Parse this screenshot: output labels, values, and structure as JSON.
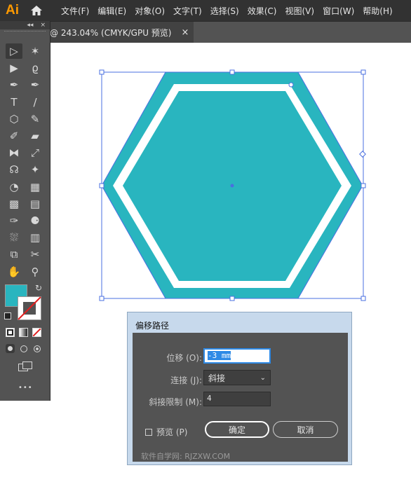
{
  "app": {
    "logo": "Ai"
  },
  "menu": [
    "文件(F)",
    "编辑(E)",
    "对象(O)",
    "文字(T)",
    "选择(S)",
    "效果(C)",
    "视图(V)",
    "窗口(W)",
    "帮助(H)"
  ],
  "toolbar_header": {
    "collapse": "◂◂",
    "close": "×"
  },
  "document_tab": {
    "title": "@ 243.04% (CMYK/GPU 预览)",
    "close": "×"
  },
  "tools": [
    {
      "name": "selection-tool",
      "glyph": "▷"
    },
    {
      "name": "magic-wand-tool",
      "glyph": "✶"
    },
    {
      "name": "direct-selection-tool",
      "glyph": "▶"
    },
    {
      "name": "lasso-tool",
      "glyph": "ϱ"
    },
    {
      "name": "pen-tool",
      "glyph": "✒"
    },
    {
      "name": "curvature-tool",
      "glyph": "✒"
    },
    {
      "name": "type-tool",
      "glyph": "T"
    },
    {
      "name": "line-segment-tool",
      "glyph": "/"
    },
    {
      "name": "polygon-tool",
      "glyph": "⬡"
    },
    {
      "name": "paintbrush-tool",
      "glyph": "✎"
    },
    {
      "name": "shaper-tool",
      "glyph": "✐"
    },
    {
      "name": "eraser-tool",
      "glyph": "▰"
    },
    {
      "name": "reflect-tool",
      "glyph": "⧓"
    },
    {
      "name": "scale-tool",
      "glyph": "⤢"
    },
    {
      "name": "warp-tool",
      "glyph": "☊"
    },
    {
      "name": "puppet-warp-tool",
      "glyph": "✦"
    },
    {
      "name": "shape-builder-tool",
      "glyph": "◔"
    },
    {
      "name": "perspective-grid-tool",
      "glyph": "▦"
    },
    {
      "name": "mesh-tool",
      "glyph": "▩"
    },
    {
      "name": "gradient-tool",
      "glyph": "▤"
    },
    {
      "name": "eyedropper-tool",
      "glyph": "✑"
    },
    {
      "name": "blend-tool",
      "glyph": "⚈"
    },
    {
      "name": "symbol-sprayer-tool",
      "glyph": "⛆"
    },
    {
      "name": "column-graph-tool",
      "glyph": "▥"
    },
    {
      "name": "artboard-tool",
      "glyph": "⧉"
    },
    {
      "name": "slice-tool",
      "glyph": "✂"
    },
    {
      "name": "hand-tool",
      "glyph": "✋"
    },
    {
      "name": "zoom-tool",
      "glyph": "⚲"
    }
  ],
  "colors": {
    "fill": "#29b5bf",
    "accent_blue": "#2e8ae6",
    "selection_blue": "#4a6fe0"
  },
  "bottom_tools": {
    "more": "•••"
  },
  "dialog": {
    "title": "偏移路径",
    "offset_label": "位移 (O):",
    "offset_value": "-3 mm",
    "joins_label": "连接 (J):",
    "joins_value": "斜接",
    "miter_label": "斜接限制 (M):",
    "miter_value": "4",
    "preview_label": "预览 (P)",
    "ok_label": "确定",
    "cancel_label": "取消",
    "watermark": "软件自学网: RJZXW.COM"
  }
}
